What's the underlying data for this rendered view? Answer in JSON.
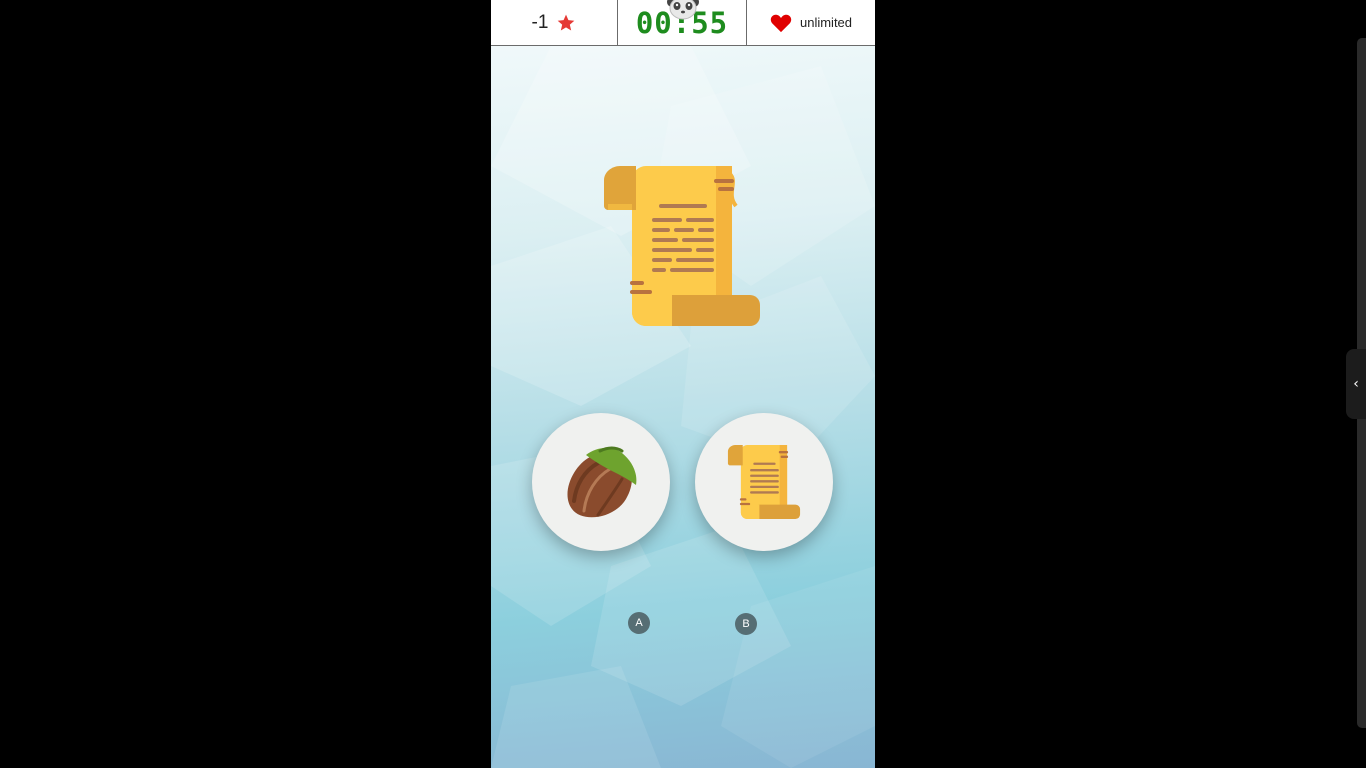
{
  "hud": {
    "score": "-1",
    "score_icon": "star-icon",
    "timer": "00:55",
    "lives": "unlimited",
    "lives_icon": "heart-icon",
    "timer_color": "#1e8c1e",
    "star_color": "#e53935",
    "heart_color": "#e00000"
  },
  "question": {
    "image": "paper-scroll-icon"
  },
  "choices": [
    {
      "key": "A",
      "image": "hazelnut-icon"
    },
    {
      "key": "B",
      "image": "paper-scroll-icon"
    }
  ],
  "side_panel": {
    "toggle_icon": "chevron-left-icon",
    "toggle_glyph": "‹"
  }
}
